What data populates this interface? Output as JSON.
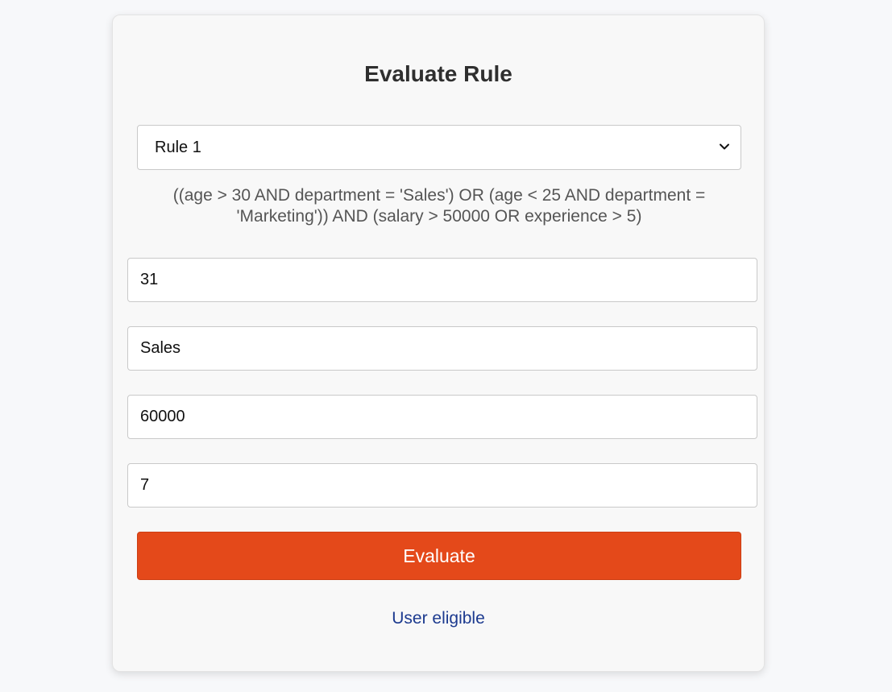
{
  "page": {
    "title": "Evaluate Rule"
  },
  "rule_select": {
    "selected": "Rule 1",
    "expression": "((age > 30 AND department = 'Sales') OR (age < 25 AND department = 'Marketing')) AND (salary > 50000 OR experience > 5)"
  },
  "inputs": {
    "age": "31",
    "department": "Sales",
    "salary": "60000",
    "experience": "7"
  },
  "actions": {
    "evaluate_label": "Evaluate"
  },
  "result": {
    "text": "User eligible"
  },
  "colors": {
    "button": "#e4491a",
    "result_text": "#1c3a8f",
    "background": "#f7f8fa"
  },
  "icons": {
    "select_arrow": "chevron-down-icon"
  }
}
